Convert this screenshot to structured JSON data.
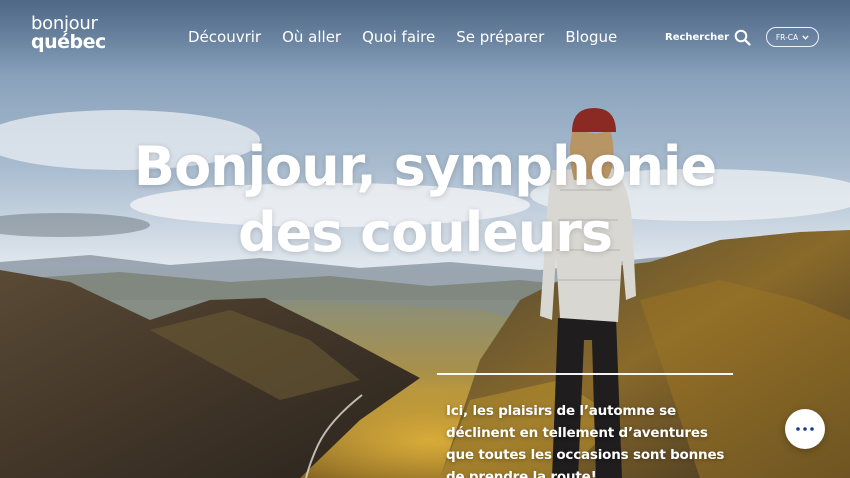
{
  "brand": {
    "logo_line1": "bonjour",
    "logo_line2": "québec"
  },
  "nav": {
    "items": [
      {
        "label": "Découvrir"
      },
      {
        "label": "Où aller"
      },
      {
        "label": "Quoi faire"
      },
      {
        "label": "Se préparer"
      },
      {
        "label": "Blogue"
      }
    ]
  },
  "search": {
    "label": "Rechercher",
    "icon": "search-icon"
  },
  "language": {
    "selected": "FR-CA",
    "icon": "chevron-down-icon"
  },
  "hero": {
    "headline_line1": "Bonjour, symphonie",
    "headline_line2": "des couleurs",
    "intro_line1": "Ici, les plaisirs de l’automne se",
    "intro_line2": "déclinent en tellement d’aventures",
    "intro_line3": "que toutes les occasions sont bonnes",
    "intro_line4": "de prendre la route!"
  },
  "fab": {
    "icon": "more-dots-icon"
  },
  "colors": {
    "text": "#ffffff",
    "sky_top": "#7f9bb6",
    "sky_low": "#dfe6ee",
    "mountain_dark": "#3a3a36",
    "autumn_gold": "#c99a2a",
    "fab_bg": "#ffffff",
    "fab_icon": "#1b3a8c"
  }
}
